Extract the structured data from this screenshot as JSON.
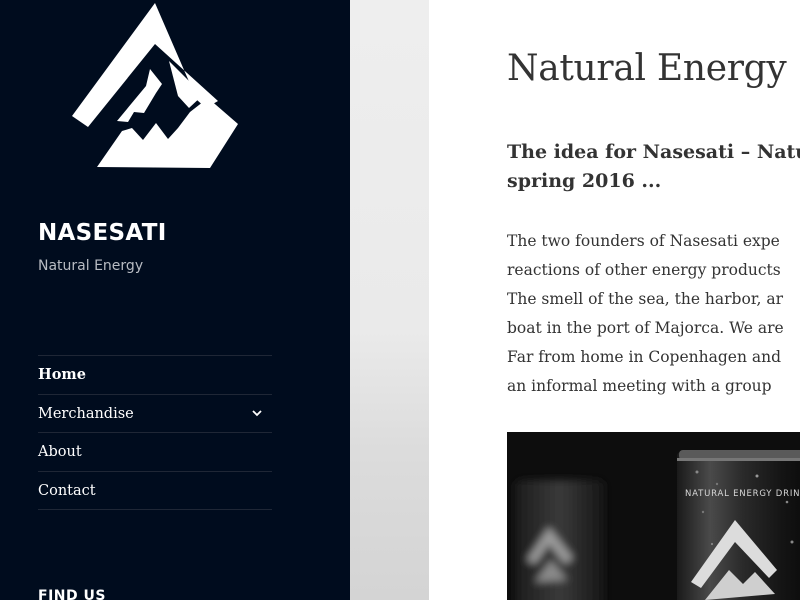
{
  "site": {
    "title": "NASESATI",
    "tagline": "Natural Energy",
    "logo_icon": "mountain-logo-icon"
  },
  "nav": {
    "items": [
      {
        "label": "Home",
        "active": true
      },
      {
        "label": "Merchandise",
        "has_submenu": true
      },
      {
        "label": "About"
      },
      {
        "label": "Contact"
      }
    ]
  },
  "widgets": {
    "find_us_title": "FIND US"
  },
  "post": {
    "title": "Natural Energy",
    "lead_lines": [
      "The idea for Nasesati – Natu",
      "spring 2016 ..."
    ],
    "body_lines": [
      "The two founders of Nasesati expe",
      "reactions of other energy products",
      "The smell of the sea, the harbor, ar",
      "boat in the port of Majorca. We are",
      "Far from home in Copenhagen and",
      "an informal meeting with a group"
    ],
    "image_caption_text": "NATURAL ENERGY DRINK"
  },
  "colors": {
    "sidebar_bg": "#000c1e",
    "content_bg": "#ffffff",
    "text": "#333333",
    "tagline": "#b8bcc3"
  }
}
